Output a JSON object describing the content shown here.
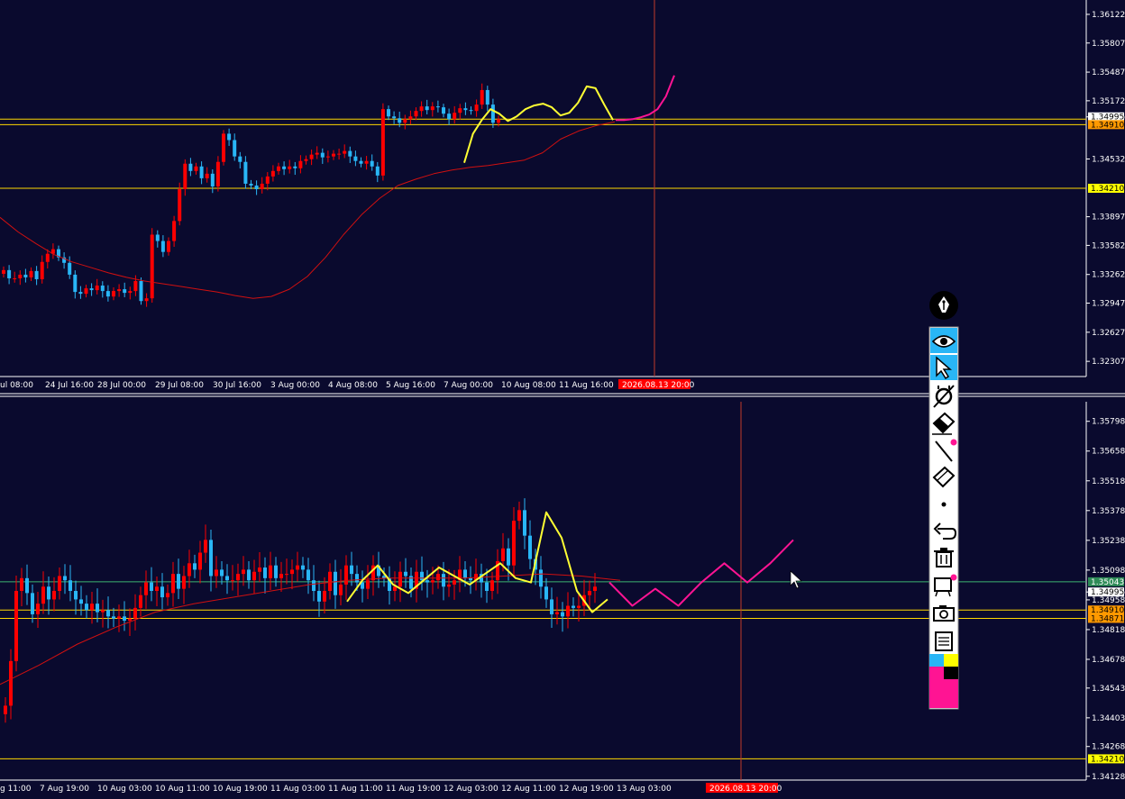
{
  "colors": {
    "background": "#0a0a2e",
    "axis_text": "#ffffff",
    "bull_candle": "#ff0000",
    "bear_candle": "#29b6f6",
    "moving_average": "#d01010",
    "hand_drawn": "#ffff33",
    "forecast": "#ff1493",
    "level_line": "#ffd700",
    "crosshair": "#c0392b",
    "label_red": "#ff0000",
    "label_orange": "#ff9900",
    "label_yellow": "#ffff00",
    "label_green": "#2e8b57",
    "toolbar_bg": "#ffffff",
    "toolbar_active": "#29b6f6"
  },
  "chart_data": [
    {
      "type": "candlestick",
      "name": "upper-pane",
      "ylim": [
        1.3214,
        1.3628
      ],
      "y_ticks": [
        "1.36122",
        "1.35807",
        "1.35487",
        "1.35172",
        "1.34995",
        "1.34532",
        "1.33897",
        "1.33582",
        "1.33262",
        "1.32947",
        "1.32627",
        "1.32307"
      ],
      "x_ticks": [
        "ul 08:00",
        "24 Jul 16:00",
        "28 Jul 00:00",
        "29 Jul 08:00",
        "30 Jul 16:00",
        "3 Aug 00:00",
        "4 Aug 08:00",
        "5 Aug 16:00",
        "7 Aug 00:00",
        "10 Aug 08:00",
        "11 Aug 16:00"
      ],
      "cursor_time_label": "2026.08.13 20:00",
      "horizontal_levels": [
        {
          "value": 1.3491,
          "label": "1.34910"
        },
        {
          "value": 1.3497,
          "label": ""
        },
        {
          "value": 1.3421,
          "label": "1.34210"
        }
      ],
      "price_labels": [
        {
          "value": 1.34995,
          "text": "1.34995",
          "style": "white"
        },
        {
          "value": 1.3491,
          "text": "1.34910",
          "style": "orange"
        },
        {
          "value": 1.3421,
          "text": "1.34210",
          "style": "yellow"
        }
      ],
      "closes": [
        1.3331,
        1.3322,
        1.3322,
        1.3326,
        1.3323,
        1.333,
        1.3321,
        1.334,
        1.3349,
        1.3354,
        1.3345,
        1.3339,
        1.3326,
        1.3307,
        1.3305,
        1.3311,
        1.3309,
        1.3314,
        1.3308,
        1.3302,
        1.3308,
        1.331,
        1.3306,
        1.3308,
        1.3319,
        1.3297,
        1.33,
        1.337,
        1.3363,
        1.3351,
        1.3363,
        1.3385,
        1.342,
        1.3448,
        1.344,
        1.3445,
        1.3432,
        1.3437,
        1.3423,
        1.345,
        1.3481,
        1.3474,
        1.3456,
        1.345,
        1.3426,
        1.3424,
        1.342,
        1.3426,
        1.3434,
        1.344,
        1.3445,
        1.3442,
        1.3445,
        1.3443,
        1.3451,
        1.3453,
        1.3458,
        1.346,
        1.3455,
        1.3456,
        1.3459,
        1.3459,
        1.3462,
        1.3456,
        1.3451,
        1.3448,
        1.3451,
        1.3445,
        1.3435,
        1.3508,
        1.35,
        1.3498,
        1.3493,
        1.3497,
        1.35,
        1.3506,
        1.3511,
        1.3507,
        1.3511,
        1.351,
        1.3503,
        1.3497,
        1.3504,
        1.3509,
        1.3507,
        1.3506,
        1.3513,
        1.3529,
        1.3513,
        1.3493,
        1.3497
      ],
      "moving_average": [
        1.3389,
        1.3373,
        1.336,
        1.3348,
        1.334,
        1.3334,
        1.3328,
        1.3323,
        1.3319,
        1.3316,
        1.3313,
        1.331,
        1.3307,
        1.3303,
        1.33,
        1.3302,
        1.331,
        1.3324,
        1.3345,
        1.337,
        1.3392,
        1.341,
        1.3424,
        1.3431,
        1.3437,
        1.3441,
        1.3444,
        1.3446,
        1.3449,
        1.3452,
        1.346,
        1.3475,
        1.3484,
        1.349,
        1.3494
      ],
      "hand_drawn": [
        1.3449,
        1.3481,
        1.3496,
        1.3508,
        1.3503,
        1.3495,
        1.35,
        1.3508,
        1.3512,
        1.3514,
        1.351,
        1.3501,
        1.3504,
        1.3515,
        1.3533,
        1.3531,
        1.3513,
        1.3496
      ],
      "forecast": [
        1.3496,
        1.3496,
        1.3497,
        1.3499,
        1.3502,
        1.3508,
        1.3522,
        1.3545
      ]
    },
    {
      "type": "candlestick",
      "name": "lower-pane",
      "ylim": [
        1.3411,
        1.3589
      ],
      "y_ticks": [
        "1.35798",
        "1.35658",
        "1.35518",
        "1.35378",
        "1.35238",
        "1.35098",
        "1.34995",
        "1.34958",
        "1.34818",
        "1.34678",
        "1.34543",
        "1.34403",
        "1.34268",
        "1.34128"
      ],
      "x_ticks": [
        "g 11:00",
        "7 Aug 19:00",
        "10 Aug 03:00",
        "10 Aug 11:00",
        "10 Aug 19:00",
        "11 Aug 03:00",
        "11 Aug 11:00",
        "11 Aug 19:00",
        "12 Aug 03:00",
        "12 Aug 11:00",
        "12 Aug 19:00",
        "13 Aug 03:00"
      ],
      "cursor_time_label": "2026.08.13 20:00",
      "horizontal_levels": [
        {
          "value": 1.35043,
          "label": "1.35043"
        },
        {
          "value": 1.3491,
          "label": "1.34910"
        },
        {
          "value": 1.34871,
          "label": "1.34871"
        },
        {
          "value": 1.3421,
          "label": "1.34210"
        }
      ],
      "price_labels": [
        {
          "value": 1.35043,
          "text": "1.35043",
          "style": "green"
        },
        {
          "value": 1.34995,
          "text": "1.34995",
          "style": "white"
        },
        {
          "value": 1.3491,
          "text": "1.34910",
          "style": "orange"
        },
        {
          "value": 1.34871,
          "text": "1.34871",
          "style": "orange"
        },
        {
          "value": 1.3421,
          "text": "1.34210",
          "style": "yellow"
        }
      ],
      "closes": [
        1.3446,
        1.3467,
        1.35,
        1.3506,
        1.3499,
        1.3489,
        1.3494,
        1.3502,
        1.3496,
        1.35,
        1.3507,
        1.3505,
        1.35,
        1.3496,
        1.3494,
        1.3491,
        1.3494,
        1.349,
        1.3491,
        1.3488,
        1.3487,
        1.3488,
        1.3486,
        1.3487,
        1.3492,
        1.3498,
        1.3504,
        1.35,
        1.3502,
        1.3497,
        1.3499,
        1.3508,
        1.3501,
        1.3507,
        1.3513,
        1.351,
        1.3518,
        1.3524,
        1.3507,
        1.351,
        1.3507,
        1.3505,
        1.3505,
        1.3508,
        1.351,
        1.3505,
        1.3509,
        1.3511,
        1.3506,
        1.3512,
        1.3506,
        1.3508,
        1.3508,
        1.351,
        1.3512,
        1.351,
        1.3505,
        1.35,
        1.3495,
        1.35,
        1.3509,
        1.3498,
        1.3503,
        1.3512,
        1.3508,
        1.3504,
        1.3501,
        1.3505,
        1.3512,
        1.3507,
        1.3506,
        1.35,
        1.3502,
        1.3509,
        1.3507,
        1.3501,
        1.3509,
        1.3505,
        1.3504,
        1.3505,
        1.3508,
        1.3502,
        1.3503,
        1.3505,
        1.351,
        1.3506,
        1.3505,
        1.3508,
        1.3504,
        1.35,
        1.3505,
        1.3514,
        1.352,
        1.3512,
        1.3533,
        1.3538,
        1.3526,
        1.3515,
        1.351,
        1.3502,
        1.3496,
        1.3489,
        1.349,
        1.3488,
        1.3493,
        1.3492,
        1.3493,
        1.3498,
        1.35,
        1.3502
      ],
      "moving_average": [
        1.3456,
        1.3465,
        1.3475,
        1.3483,
        1.349,
        1.3494,
        1.3497,
        1.35,
        1.3503,
        1.3505,
        1.3506,
        1.3506,
        1.3506,
        1.3507,
        1.3508,
        1.3507,
        1.3505
      ],
      "hand_drawn": [
        1.3495,
        1.3505,
        1.3512,
        1.3503,
        1.3499,
        1.3505,
        1.3511,
        1.3507,
        1.3503,
        1.3508,
        1.3513,
        1.3506,
        1.3504,
        1.3537,
        1.3525,
        1.35,
        1.349,
        1.3496
      ],
      "forecast": [
        1.3504,
        1.3493,
        1.3501,
        1.3493,
        1.3504,
        1.3513,
        1.3504,
        1.3513,
        1.3524
      ]
    }
  ],
  "toolbar": {
    "items": [
      "pen-logo",
      "eye",
      "select-arrow",
      "magnet",
      "eraser-tool",
      "line-tool",
      "clear-eraser",
      "dot",
      "undo",
      "trash",
      "template",
      "camera",
      "clipboard"
    ]
  }
}
